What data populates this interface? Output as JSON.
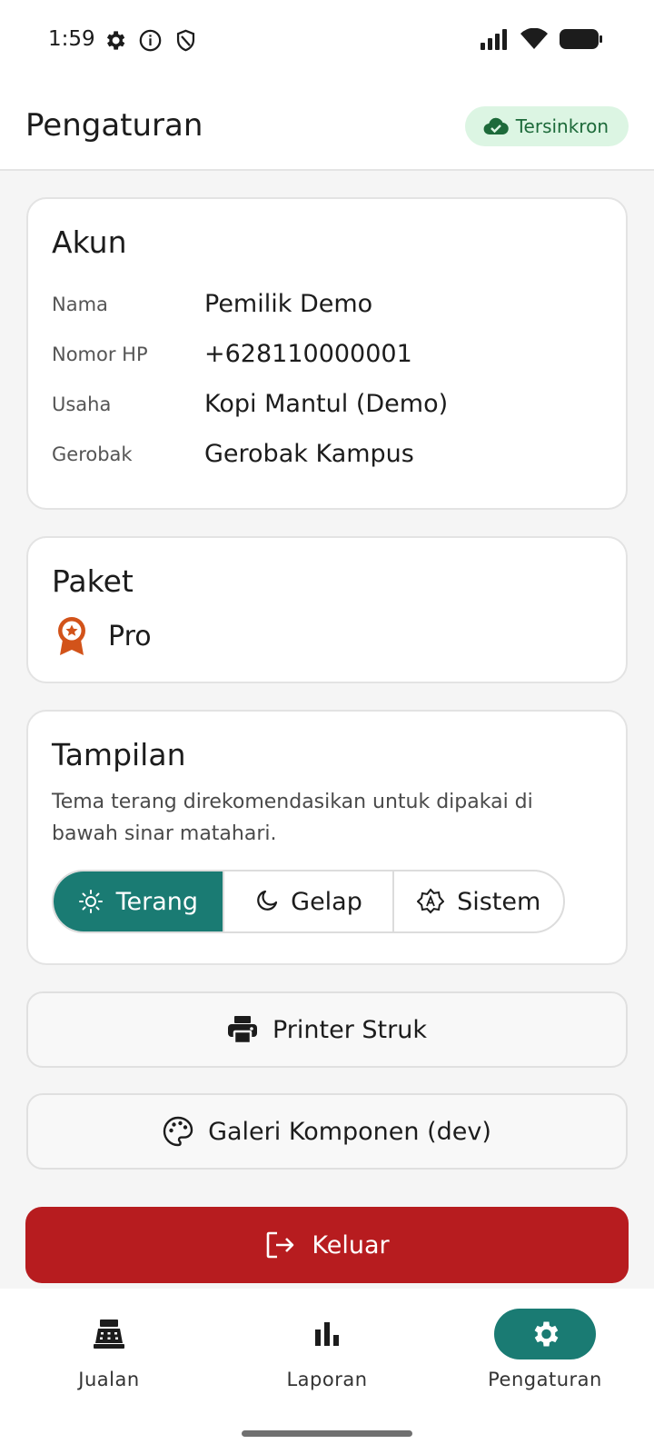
{
  "status_bar": {
    "time": "1:59",
    "left_icons": [
      "gear-icon",
      "info-icon",
      "shield-icon"
    ],
    "right_icons": [
      "signal-icon",
      "wifi-icon",
      "battery-icon"
    ]
  },
  "header": {
    "title": "Pengaturan",
    "sync_badge": {
      "label": "Tersinkron",
      "icon": "cloud-check-icon"
    }
  },
  "akun": {
    "title": "Akun",
    "rows": [
      {
        "label": "Nama",
        "value": "Pemilik Demo"
      },
      {
        "label": "Nomor HP",
        "value": "+628110000001"
      },
      {
        "label": "Usaha",
        "value": "Kopi Mantul (Demo)"
      },
      {
        "label": "Gerobak",
        "value": "Gerobak Kampus"
      }
    ]
  },
  "paket": {
    "title": "Paket",
    "plan": "Pro",
    "icon": "award-badge-icon"
  },
  "tampilan": {
    "title": "Tampilan",
    "description": "Tema terang direkomendasikan untuk dipakai di bawah sinar matahari.",
    "options": [
      {
        "label": "Terang",
        "icon": "sun-icon",
        "selected": true
      },
      {
        "label": "Gelap",
        "icon": "moon-icon",
        "selected": false
      },
      {
        "label": "Sistem",
        "icon": "auto-theme-icon",
        "selected": false
      }
    ]
  },
  "buttons": {
    "printer": "Printer Struk",
    "galeri": "Galeri Komponen (dev)",
    "logout": "Keluar"
  },
  "bottom_nav": {
    "items": [
      {
        "label": "Jualan",
        "icon": "cash-register-icon",
        "active": false
      },
      {
        "label": "Laporan",
        "icon": "bar-chart-icon",
        "active": false
      },
      {
        "label": "Pengaturan",
        "icon": "gear-icon",
        "active": true
      }
    ]
  },
  "colors": {
    "accent": "#1a7b73",
    "danger": "#b71c1f",
    "sync_bg": "#dcf5e3",
    "sync_text": "#1d6a3a",
    "badge": "#d2531a"
  }
}
